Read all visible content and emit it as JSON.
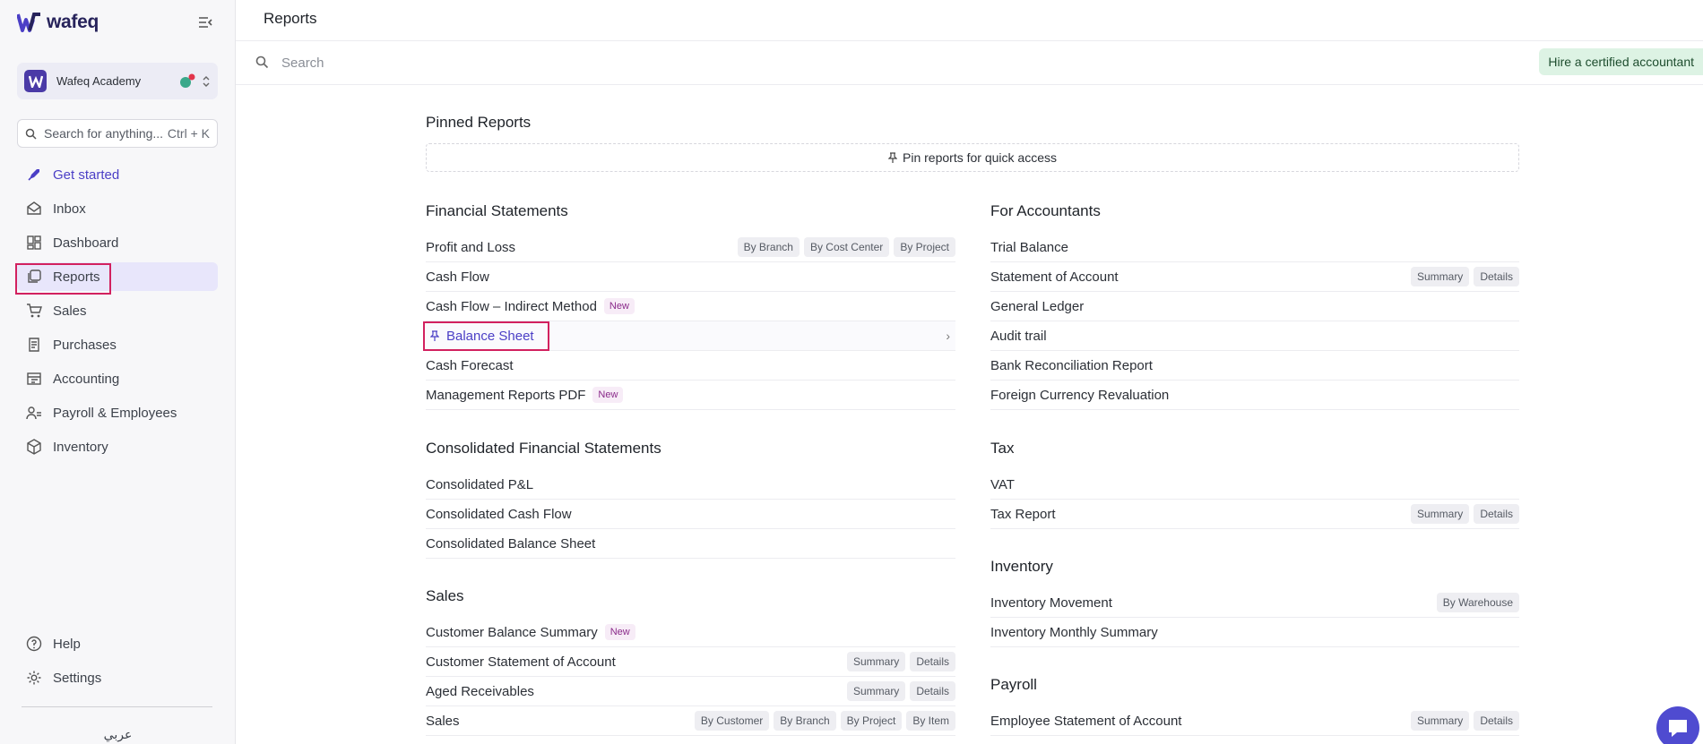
{
  "app": {
    "logo_text": "wafeq"
  },
  "sidebar": {
    "org_name": "Wafeq Academy",
    "search_placeholder": "Search for anything...",
    "search_shortcut": "Ctrl + K",
    "items": [
      {
        "label": "Get started",
        "icon": "rocket-icon"
      },
      {
        "label": "Inbox",
        "icon": "inbox-icon"
      },
      {
        "label": "Dashboard",
        "icon": "dashboard-icon"
      },
      {
        "label": "Reports",
        "icon": "reports-icon"
      },
      {
        "label": "Sales",
        "icon": "cart-icon"
      },
      {
        "label": "Purchases",
        "icon": "receipt-icon"
      },
      {
        "label": "Accounting",
        "icon": "ledger-icon"
      },
      {
        "label": "Payroll & Employees",
        "icon": "people-icon"
      },
      {
        "label": "Inventory",
        "icon": "box-icon"
      }
    ],
    "bottom_items": [
      {
        "label": "Help",
        "icon": "help-icon"
      },
      {
        "label": "Settings",
        "icon": "gear-icon"
      }
    ],
    "language": "عربي"
  },
  "header": {
    "title": "Reports"
  },
  "search": {
    "placeholder": "Search"
  },
  "hire_button": "Hire a certified accountant",
  "pinned": {
    "title": "Pinned Reports",
    "empty_text": "Pin reports for quick access"
  },
  "sections": {
    "financial": {
      "title": "Financial Statements",
      "rows": [
        {
          "name": "Profit and Loss",
          "tags": [
            "By Branch",
            "By Cost Center",
            "By Project"
          ]
        },
        {
          "name": "Cash Flow"
        },
        {
          "name": "Cash Flow – Indirect Method",
          "badge": "New"
        },
        {
          "name": "Balance Sheet"
        },
        {
          "name": "Cash Forecast"
        },
        {
          "name": "Management Reports PDF",
          "badge": "New"
        }
      ]
    },
    "consolidated": {
      "title": "Consolidated Financial Statements",
      "rows": [
        {
          "name": "Consolidated P&L"
        },
        {
          "name": "Consolidated Cash Flow"
        },
        {
          "name": "Consolidated Balance Sheet"
        }
      ]
    },
    "sales": {
      "title": "Sales",
      "rows": [
        {
          "name": "Customer Balance Summary",
          "badge": "New"
        },
        {
          "name": "Customer Statement of Account",
          "tags": [
            "Summary",
            "Details"
          ]
        },
        {
          "name": "Aged Receivables",
          "tags": [
            "Summary",
            "Details"
          ]
        },
        {
          "name": "Sales",
          "tags": [
            "By Customer",
            "By Branch",
            "By Project",
            "By Item"
          ]
        }
      ]
    },
    "accountants": {
      "title": "For Accountants",
      "rows": [
        {
          "name": "Trial Balance"
        },
        {
          "name": "Statement of Account",
          "tags": [
            "Summary",
            "Details"
          ]
        },
        {
          "name": "General Ledger"
        },
        {
          "name": "Audit trail"
        },
        {
          "name": "Bank Reconciliation Report"
        },
        {
          "name": "Foreign Currency Revaluation"
        }
      ]
    },
    "tax": {
      "title": "Tax",
      "rows": [
        {
          "name": "VAT"
        },
        {
          "name": "Tax Report",
          "tags": [
            "Summary",
            "Details"
          ]
        }
      ]
    },
    "inventory": {
      "title": "Inventory",
      "rows": [
        {
          "name": "Inventory Movement",
          "tags": [
            "By Warehouse"
          ]
        },
        {
          "name": "Inventory Monthly Summary"
        }
      ]
    },
    "payroll": {
      "title": "Payroll",
      "rows": [
        {
          "name": "Employee Statement of Account",
          "tags": [
            "Summary",
            "Details"
          ]
        }
      ]
    }
  },
  "colors": {
    "accent": "#4b3fc6",
    "highlight": "#d2215f",
    "hire_bg": "#ddf3e4"
  }
}
